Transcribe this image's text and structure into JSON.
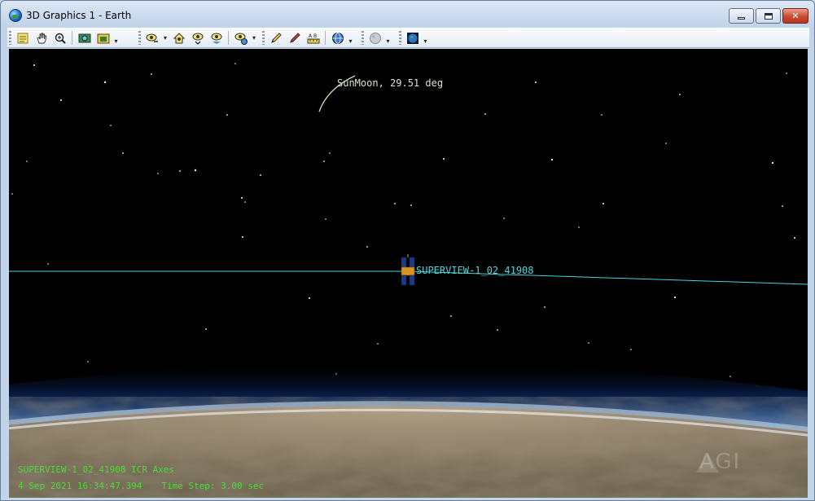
{
  "window": {
    "title": "3D Graphics 1 - Earth",
    "minimize_label": "",
    "close_label": "✕"
  },
  "toolbar": {
    "groups": [
      [
        "properties-icon",
        "pan-icon",
        "zoom-icon",
        "map-icon",
        "snapshot-icon"
      ],
      [
        "view-from-icon",
        "home-view-icon",
        "view-to-icon",
        "orient-view-icon",
        "globe-view-icon"
      ],
      [
        "pencil-icon",
        "red-pencil-icon",
        "measure-icon"
      ],
      [
        "network-globe-icon"
      ],
      [
        "moon-icon"
      ],
      [
        "earth-icon"
      ]
    ]
  },
  "scene": {
    "sunmoon_label": "SunMoon, 29.51 deg",
    "satellite_label": "SUPERVIEW-1_02_41908",
    "colors": {
      "space": "#000000",
      "orbit_line": "#44d6dc",
      "status_text": "#4bdc3b",
      "atmosphere": "#6fa0d8"
    }
  },
  "status": {
    "axes_line": "SUPERVIEW-1_02_41908 ICR Axes",
    "datetime": "4 Sep 2021 16:34:47.394",
    "time_step": "Time Step: 3.00 sec"
  },
  "watermark": "AGI"
}
